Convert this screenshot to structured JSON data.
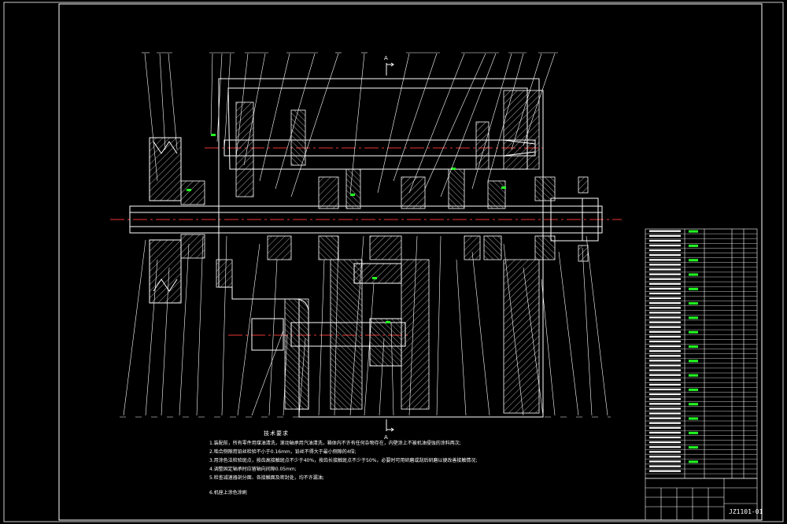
{
  "drawing": {
    "section_marker_top": "A",
    "section_marker_bottom": "A",
    "technical_requirements_title": "技术要求",
    "technical_requirements": [
      "1.装配前，所有零件用煤油清洗，滚动轴承用汽油清洗，箱体内不许有任何杂物存在，内壁涂上不被机油侵蚀的涂料两次;",
      "2.啮合侧隙用铅丝检验不小于0.16mm，铅丝不得大于最小侧隙的4倍;",
      "3.用涂色法检验斑点，按齿高接触斑点不少于40%，按齿长接触斑点不少于50%，必要时可用研磨或刮后研磨以便改善接触情况;",
      "4.调整固定轴承时应留轴向间隙0.05mm;",
      "5.检查减速器剖分面、各接触面及密封处，均不许漏油;",
      "6.机座上涂色涂刷"
    ],
    "drawing_number": "JZ1101-01"
  }
}
